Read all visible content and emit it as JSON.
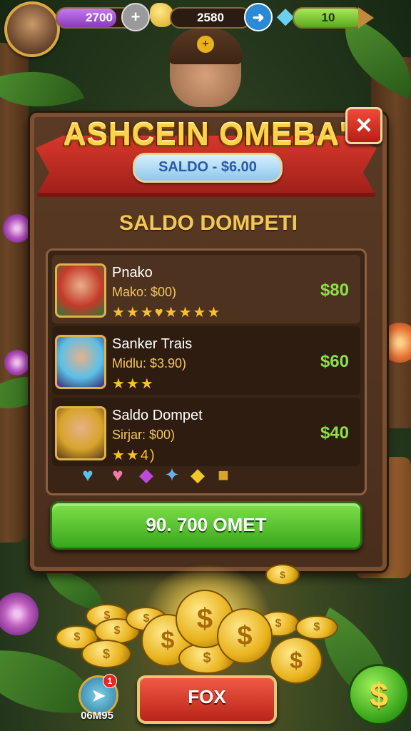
{
  "hud": {
    "energy_value": "2700",
    "coins_value": "2580",
    "gems_value": "10",
    "add_icon": "plus-icon",
    "arrow_icon": "arrow-right-icon",
    "colors": {
      "energy_fill": "#a85ad8",
      "gems_fill": "#7acc2a"
    }
  },
  "panel": {
    "title": "ASHCEIN OMEBA'",
    "saldo_pill": "SALDO - $6.00",
    "subtitle": "SALDO DOMPETI",
    "close_label": "✕"
  },
  "rows": [
    {
      "name": "Pnako",
      "sub": "Mako: $00)",
      "stars": "★★★♥★★★★",
      "price": "$80"
    },
    {
      "name": "Sanker Trais",
      "sub": "Midlu: $3.90)",
      "stars": "★★★",
      "price": "$60"
    },
    {
      "name": "Saldo Dompet",
      "sub": "Sirjar: $00)",
      "stars": "★★4)",
      "price": "$40"
    }
  ],
  "gems_row": [
    "heart-blue-icon",
    "heart-pink-icon",
    "gem-purple-icon",
    "star-blue-icon",
    "gem-yellow-icon",
    "gem-gold-icon"
  ],
  "cta_label": "90. 700 OMET",
  "bottom": {
    "fox_label": "FOX",
    "compass_label": "06M95",
    "compass_badge": "1",
    "dollar_symbol": "$"
  }
}
